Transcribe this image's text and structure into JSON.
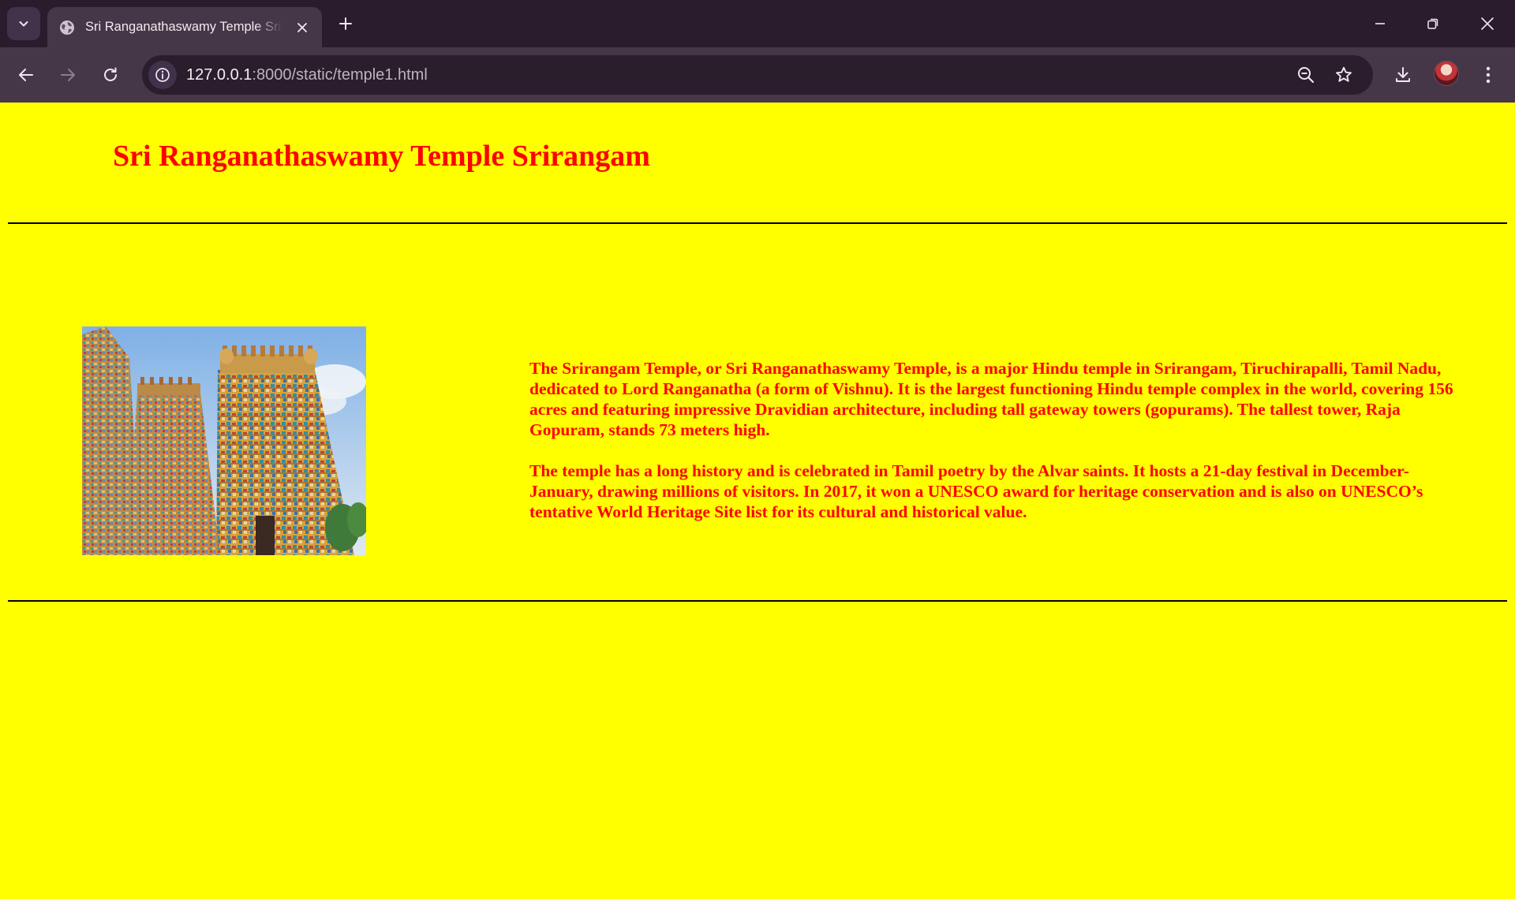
{
  "browser": {
    "tab_title": "Sri Ranganathaswamy Temple Srirangam",
    "url_host": "127.0.0.1",
    "url_path": ":8000/static/temple1.html",
    "chrome_color": "#2b1c2d",
    "toolbar_color": "#453747"
  },
  "page": {
    "background": "#ffff00",
    "text_color": "#ff0000",
    "title": "Sri Ranganathaswamy Temple Srirangam",
    "paragraphs": [
      "The Srirangam Temple, or Sri Ranganathaswamy Temple, is a major Hindu temple in Srirangam, Tiruchirapalli, Tamil Nadu, dedicated to Lord Ranganatha (a form of Vishnu). It is the largest functioning Hindu temple complex in the world, covering 156 acres and featuring impressive Dravidian architecture, including tall gateway towers (gopurams). The tallest tower, Raja Gopuram, stands 73 meters high.",
      "The temple has a long history and is celebrated in Tamil poetry by the Alvar saints. It hosts a 21-day festival in December-January, drawing millions of visitors. In 2017, it won a UNESCO award for heritage conservation and is also on UNESCO’s tentative World Heritage Site list for its cultural and historical value."
    ]
  },
  "icons": {
    "tab_list": "chevron-down-icon",
    "favicon": "globe-icon",
    "tab_close": "close-icon",
    "new_tab": "plus-icon",
    "minimize": "minimize-icon",
    "restore": "restore-icon",
    "close_window": "close-icon",
    "back": "arrow-left-icon",
    "forward": "arrow-right-icon",
    "reload": "reload-icon",
    "site_info": "info-icon",
    "zoom": "zoom-out-icon",
    "bookmark": "star-icon",
    "downloads": "download-icon",
    "menu": "kebab-menu-icon"
  }
}
